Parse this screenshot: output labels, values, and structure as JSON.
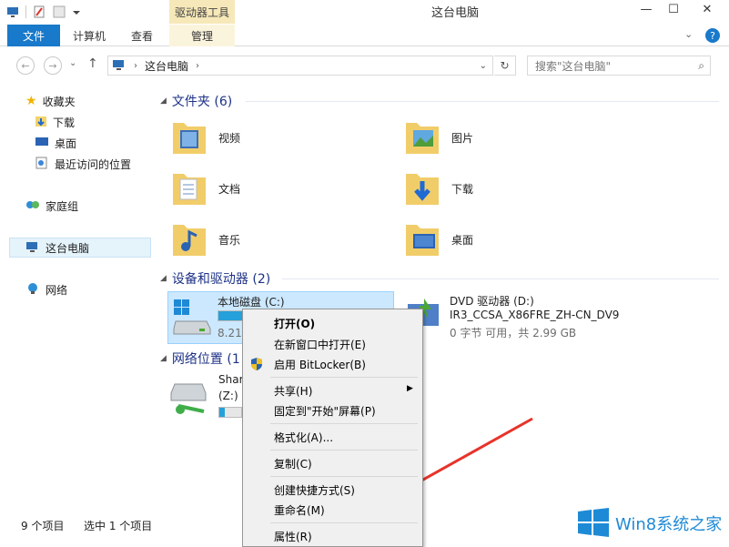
{
  "window": {
    "title": "这台电脑",
    "contextual_tab_group": "驱动器工具",
    "controls": {
      "minimize": "—",
      "maximize": "☐",
      "close": "✕"
    }
  },
  "ribbon": {
    "file_tab": "文件",
    "tabs": [
      "计算机",
      "查看",
      "管理"
    ],
    "help": "?"
  },
  "address": {
    "path": [
      "这台电脑"
    ],
    "search_placeholder": "搜索\"这台电脑\""
  },
  "nav": {
    "favorites": "收藏夹",
    "favorites_items": [
      "下载",
      "桌面",
      "最近访问的位置"
    ],
    "homegroup": "家庭组",
    "this_pc": "这台电脑",
    "network": "网络"
  },
  "groups": {
    "folders": {
      "title": "文件夹 (6)",
      "items": [
        "视频",
        "图片",
        "文档",
        "下载",
        "音乐",
        "桌面"
      ]
    },
    "devices": {
      "title": "设备和驱动器 (2)",
      "drive_c": {
        "name": "本地磁盘 (C:)",
        "space_prefix": "8.21",
        "used_fraction": 0.42
      },
      "dvd": {
        "name": "DVD 驱动器 (D:)",
        "label": "IR3_CCSA_X86FRE_ZH-CN_DV9",
        "space": "0 字节 可用，共 2.99 GB"
      }
    },
    "network_locations": {
      "title_prefix": "网络位置 (1",
      "share": {
        "name_prefix": "Shar",
        "drive": "(Z:)",
        "used_fraction": 0.25
      }
    }
  },
  "context_menu": {
    "items": [
      {
        "label": "打开(O)",
        "bold": true
      },
      {
        "label": "在新窗口中打开(E)"
      },
      {
        "label": "启用 BitLocker(B)",
        "icon": "shield-icon"
      },
      {
        "label": "共享(H)",
        "submenu": true
      },
      {
        "label": "固定到\"开始\"屏幕(P)"
      },
      {
        "label": "格式化(A)..."
      },
      {
        "label": "复制(C)"
      },
      {
        "label": "创建快捷方式(S)"
      },
      {
        "label": "重命名(M)"
      },
      {
        "label": "属性(R)"
      }
    ]
  },
  "status": {
    "item_count": "9 个项目",
    "selected": "选中 1 个项目"
  },
  "watermark": {
    "text": "Win8系统之家"
  },
  "colors": {
    "accent": "#1979ca",
    "selection": "#cce8ff",
    "arrow": "#e8332a",
    "bar_fill": "#26a0da"
  }
}
